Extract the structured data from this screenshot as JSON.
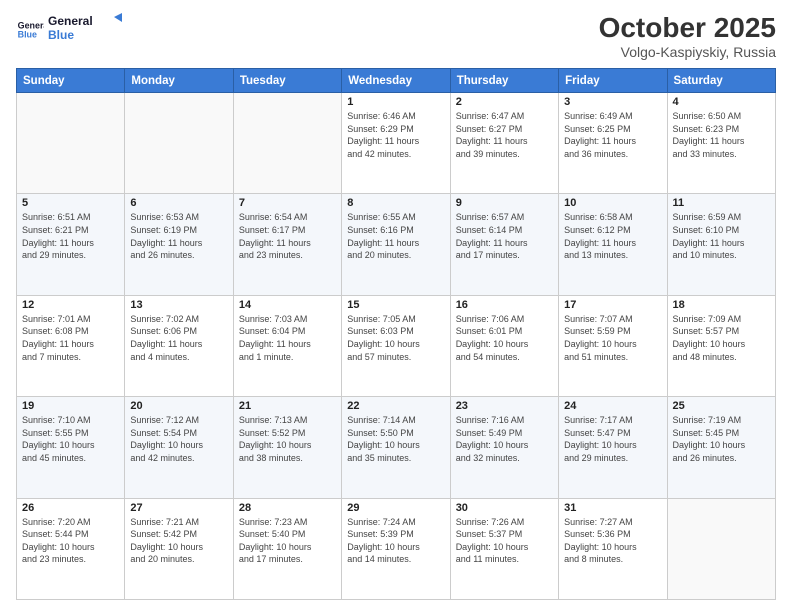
{
  "header": {
    "logo_line1": "General",
    "logo_line2": "Blue",
    "month": "October 2025",
    "location": "Volgo-Kaspiyskiy, Russia"
  },
  "weekdays": [
    "Sunday",
    "Monday",
    "Tuesday",
    "Wednesday",
    "Thursday",
    "Friday",
    "Saturday"
  ],
  "weeks": [
    [
      {
        "day": "",
        "info": ""
      },
      {
        "day": "",
        "info": ""
      },
      {
        "day": "",
        "info": ""
      },
      {
        "day": "1",
        "info": "Sunrise: 6:46 AM\nSunset: 6:29 PM\nDaylight: 11 hours\nand 42 minutes."
      },
      {
        "day": "2",
        "info": "Sunrise: 6:47 AM\nSunset: 6:27 PM\nDaylight: 11 hours\nand 39 minutes."
      },
      {
        "day": "3",
        "info": "Sunrise: 6:49 AM\nSunset: 6:25 PM\nDaylight: 11 hours\nand 36 minutes."
      },
      {
        "day": "4",
        "info": "Sunrise: 6:50 AM\nSunset: 6:23 PM\nDaylight: 11 hours\nand 33 minutes."
      }
    ],
    [
      {
        "day": "5",
        "info": "Sunrise: 6:51 AM\nSunset: 6:21 PM\nDaylight: 11 hours\nand 29 minutes."
      },
      {
        "day": "6",
        "info": "Sunrise: 6:53 AM\nSunset: 6:19 PM\nDaylight: 11 hours\nand 26 minutes."
      },
      {
        "day": "7",
        "info": "Sunrise: 6:54 AM\nSunset: 6:17 PM\nDaylight: 11 hours\nand 23 minutes."
      },
      {
        "day": "8",
        "info": "Sunrise: 6:55 AM\nSunset: 6:16 PM\nDaylight: 11 hours\nand 20 minutes."
      },
      {
        "day": "9",
        "info": "Sunrise: 6:57 AM\nSunset: 6:14 PM\nDaylight: 11 hours\nand 17 minutes."
      },
      {
        "day": "10",
        "info": "Sunrise: 6:58 AM\nSunset: 6:12 PM\nDaylight: 11 hours\nand 13 minutes."
      },
      {
        "day": "11",
        "info": "Sunrise: 6:59 AM\nSunset: 6:10 PM\nDaylight: 11 hours\nand 10 minutes."
      }
    ],
    [
      {
        "day": "12",
        "info": "Sunrise: 7:01 AM\nSunset: 6:08 PM\nDaylight: 11 hours\nand 7 minutes."
      },
      {
        "day": "13",
        "info": "Sunrise: 7:02 AM\nSunset: 6:06 PM\nDaylight: 11 hours\nand 4 minutes."
      },
      {
        "day": "14",
        "info": "Sunrise: 7:03 AM\nSunset: 6:04 PM\nDaylight: 11 hours\nand 1 minute."
      },
      {
        "day": "15",
        "info": "Sunrise: 7:05 AM\nSunset: 6:03 PM\nDaylight: 10 hours\nand 57 minutes."
      },
      {
        "day": "16",
        "info": "Sunrise: 7:06 AM\nSunset: 6:01 PM\nDaylight: 10 hours\nand 54 minutes."
      },
      {
        "day": "17",
        "info": "Sunrise: 7:07 AM\nSunset: 5:59 PM\nDaylight: 10 hours\nand 51 minutes."
      },
      {
        "day": "18",
        "info": "Sunrise: 7:09 AM\nSunset: 5:57 PM\nDaylight: 10 hours\nand 48 minutes."
      }
    ],
    [
      {
        "day": "19",
        "info": "Sunrise: 7:10 AM\nSunset: 5:55 PM\nDaylight: 10 hours\nand 45 minutes."
      },
      {
        "day": "20",
        "info": "Sunrise: 7:12 AM\nSunset: 5:54 PM\nDaylight: 10 hours\nand 42 minutes."
      },
      {
        "day": "21",
        "info": "Sunrise: 7:13 AM\nSunset: 5:52 PM\nDaylight: 10 hours\nand 38 minutes."
      },
      {
        "day": "22",
        "info": "Sunrise: 7:14 AM\nSunset: 5:50 PM\nDaylight: 10 hours\nand 35 minutes."
      },
      {
        "day": "23",
        "info": "Sunrise: 7:16 AM\nSunset: 5:49 PM\nDaylight: 10 hours\nand 32 minutes."
      },
      {
        "day": "24",
        "info": "Sunrise: 7:17 AM\nSunset: 5:47 PM\nDaylight: 10 hours\nand 29 minutes."
      },
      {
        "day": "25",
        "info": "Sunrise: 7:19 AM\nSunset: 5:45 PM\nDaylight: 10 hours\nand 26 minutes."
      }
    ],
    [
      {
        "day": "26",
        "info": "Sunrise: 7:20 AM\nSunset: 5:44 PM\nDaylight: 10 hours\nand 23 minutes."
      },
      {
        "day": "27",
        "info": "Sunrise: 7:21 AM\nSunset: 5:42 PM\nDaylight: 10 hours\nand 20 minutes."
      },
      {
        "day": "28",
        "info": "Sunrise: 7:23 AM\nSunset: 5:40 PM\nDaylight: 10 hours\nand 17 minutes."
      },
      {
        "day": "29",
        "info": "Sunrise: 7:24 AM\nSunset: 5:39 PM\nDaylight: 10 hours\nand 14 minutes."
      },
      {
        "day": "30",
        "info": "Sunrise: 7:26 AM\nSunset: 5:37 PM\nDaylight: 10 hours\nand 11 minutes."
      },
      {
        "day": "31",
        "info": "Sunrise: 7:27 AM\nSunset: 5:36 PM\nDaylight: 10 hours\nand 8 minutes."
      },
      {
        "day": "",
        "info": ""
      }
    ]
  ]
}
